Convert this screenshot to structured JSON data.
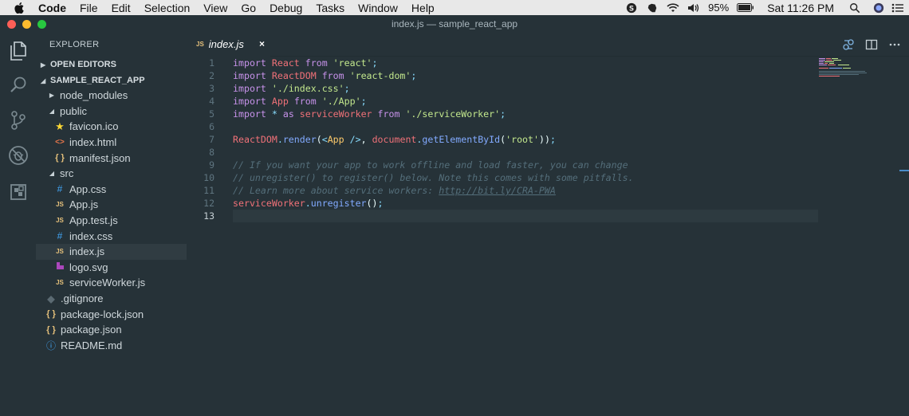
{
  "menubar": {
    "app_name": "Code",
    "items": [
      "File",
      "Edit",
      "Selection",
      "View",
      "Go",
      "Debug",
      "Tasks",
      "Window",
      "Help"
    ],
    "battery": "95%",
    "clock": "Sat 11:26 PM"
  },
  "window": {
    "title": "index.js — sample_react_app"
  },
  "sidebar": {
    "title": "EXPLORER",
    "open_editors": "OPEN EDITORS",
    "project": "SAMPLE_REACT_APP",
    "tree": [
      {
        "label": "node_modules",
        "icon": "chevron-right-icon"
      },
      {
        "label": "public",
        "icon": "chevron-down-icon"
      },
      {
        "label": "favicon.ico",
        "icon": "star-icon"
      },
      {
        "label": "index.html",
        "icon": "html-file-icon"
      },
      {
        "label": "manifest.json",
        "icon": "json-file-icon"
      },
      {
        "label": "src",
        "icon": "chevron-down-icon"
      },
      {
        "label": "App.css",
        "icon": "css-file-icon"
      },
      {
        "label": "App.js",
        "icon": "js-file-icon"
      },
      {
        "label": "App.test.js",
        "icon": "js-file-icon"
      },
      {
        "label": "index.css",
        "icon": "css-file-icon"
      },
      {
        "label": "index.js",
        "icon": "js-file-icon"
      },
      {
        "label": "logo.svg",
        "icon": "svg-file-icon"
      },
      {
        "label": "serviceWorker.js",
        "icon": "js-file-icon"
      },
      {
        "label": ".gitignore",
        "icon": "git-file-icon"
      },
      {
        "label": "package-lock.json",
        "icon": "json-file-icon"
      },
      {
        "label": "package.json",
        "icon": "json-file-icon"
      },
      {
        "label": "README.md",
        "icon": "info-file-icon"
      }
    ]
  },
  "tab": {
    "icon_text": "JS",
    "label": "index.js",
    "close": "×"
  },
  "file_icons": {
    "js": "JS",
    "css": "#",
    "json": "{ }",
    "html": "<>",
    "star": "★",
    "info": "ⓘ"
  },
  "editor": {
    "line_numbers": [
      "1",
      "2",
      "3",
      "4",
      "5",
      "6",
      "7",
      "8",
      "9",
      "10",
      "11",
      "12",
      "13"
    ],
    "current_line": 13,
    "lines": [
      [
        [
          "k",
          "import"
        ],
        [
          "pl",
          " "
        ],
        [
          "v",
          "React"
        ],
        [
          "pl",
          " "
        ],
        [
          "k",
          "from"
        ],
        [
          "pl",
          " "
        ],
        [
          "s",
          "'react'"
        ],
        [
          "p",
          ";"
        ]
      ],
      [
        [
          "k",
          "import"
        ],
        [
          "pl",
          " "
        ],
        [
          "v",
          "ReactDOM"
        ],
        [
          "pl",
          " "
        ],
        [
          "k",
          "from"
        ],
        [
          "pl",
          " "
        ],
        [
          "s",
          "'react-dom'"
        ],
        [
          "p",
          ";"
        ]
      ],
      [
        [
          "k",
          "import"
        ],
        [
          "pl",
          " "
        ],
        [
          "s",
          "'./index.css'"
        ],
        [
          "p",
          ";"
        ]
      ],
      [
        [
          "k",
          "import"
        ],
        [
          "pl",
          " "
        ],
        [
          "v",
          "App"
        ],
        [
          "pl",
          " "
        ],
        [
          "k",
          "from"
        ],
        [
          "pl",
          " "
        ],
        [
          "s",
          "'./App'"
        ],
        [
          "p",
          ";"
        ]
      ],
      [
        [
          "k",
          "import"
        ],
        [
          "pl",
          " "
        ],
        [
          "p",
          "*"
        ],
        [
          "pl",
          " "
        ],
        [
          "k",
          "as"
        ],
        [
          "pl",
          " "
        ],
        [
          "v",
          "serviceWorker"
        ],
        [
          "pl",
          " "
        ],
        [
          "k",
          "from"
        ],
        [
          "pl",
          " "
        ],
        [
          "s",
          "'./serviceWorker'"
        ],
        [
          "p",
          ";"
        ]
      ],
      [],
      [
        [
          "v",
          "ReactDOM"
        ],
        [
          "p",
          "."
        ],
        [
          "fn",
          "render"
        ],
        [
          "pl",
          "("
        ],
        [
          "p",
          "<"
        ],
        [
          "t",
          "App"
        ],
        [
          "pl",
          " "
        ],
        [
          "p",
          "/>"
        ],
        [
          "pl",
          ", "
        ],
        [
          "v",
          "document"
        ],
        [
          "p",
          "."
        ],
        [
          "fn",
          "getElementById"
        ],
        [
          "pl",
          "("
        ],
        [
          "s",
          "'root'"
        ],
        [
          "pl",
          "))"
        ],
        [
          "p",
          ";"
        ]
      ],
      [],
      [
        [
          "c",
          "// If you want your app to work offline and load faster, you can change"
        ]
      ],
      [
        [
          "c",
          "// unregister() to register() below. Note this comes with some pitfalls."
        ]
      ],
      [
        [
          "c",
          "// Learn more about service workers: "
        ],
        [
          "u",
          "http://bit.ly/CRA-PWA"
        ]
      ],
      [
        [
          "v",
          "serviceWorker"
        ],
        [
          "p",
          "."
        ],
        [
          "fn",
          "unregister"
        ],
        [
          "pl",
          "()"
        ],
        [
          "p",
          ";"
        ]
      ],
      []
    ]
  },
  "colors": {
    "background": "#263238",
    "menubar": "#e8e8e8",
    "keyword": "#c792ea",
    "variable": "#f07178",
    "string": "#c3e88d",
    "function": "#82aaff",
    "comment": "#546e7a"
  }
}
